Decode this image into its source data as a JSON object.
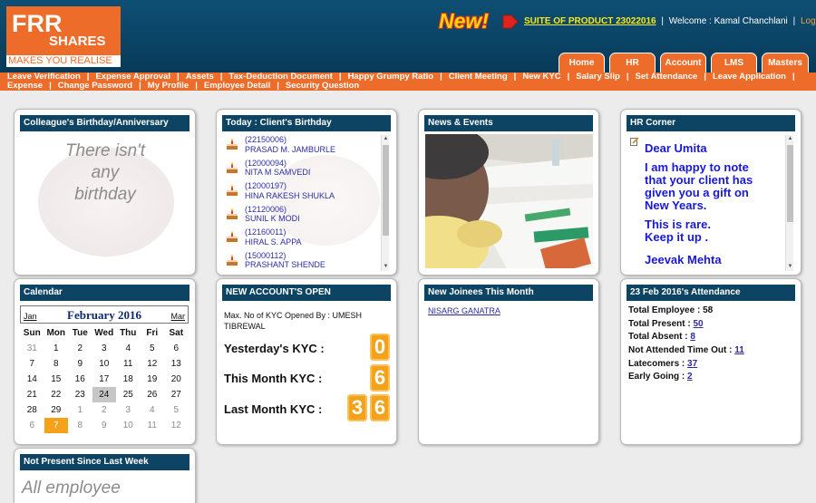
{
  "logo": {
    "line1": "FRR",
    "line2": "SHARES",
    "tagline": "MAKES YOU REALISE"
  },
  "header": {
    "new_badge": "New!",
    "suite_link": "SUITE OF PRODUCT 23022016",
    "welcome": "Welcome : Kamal Chanchlani",
    "logout": "Logout",
    "tabs": [
      "Home",
      "HR",
      "Account",
      "LMS",
      "Masters"
    ]
  },
  "menu": {
    "row1": [
      "Leave Verification",
      "Expense Approval",
      "Assets",
      "Tax-Deduction Document",
      "Happy Grumpy Ratio",
      "Client Meeting",
      "New KYC",
      "Salary Slip",
      "Set Attendance",
      "Leave Application"
    ],
    "row2": [
      "Expense",
      "Change Password",
      "My Profile",
      "Employee Detail",
      "Security Question"
    ]
  },
  "colleague_birthday": {
    "title": "Colleague's Birthday/Anniversary",
    "message": [
      "There isn't",
      "any",
      "birthday"
    ]
  },
  "client_birthday": {
    "title": "Today : Client's Birthday",
    "items": [
      {
        "code": "(22150006)",
        "name": "PRASAD M. JAMBURLE"
      },
      {
        "code": "(12000094)",
        "name": "NITA M SAMVEDI"
      },
      {
        "code": "(12000197)",
        "name": "HINA RAKESH SHUKLA"
      },
      {
        "code": "(12120006)",
        "name": "SUNIL K MODI"
      },
      {
        "code": "(12160011)",
        "name": "HIRAL S. APPA"
      },
      {
        "code": "(15000112)",
        "name": "PRASHANT SHENDE"
      }
    ]
  },
  "news": {
    "title": "News & Events"
  },
  "hr_corner": {
    "title": "HR Corner",
    "lines": [
      "Dear Umita",
      "I am happy to note",
      "that your client has",
      "given you a gift on",
      "New Years.",
      "This is rare.",
      "Keep it up .",
      "Jeevak Mehta"
    ]
  },
  "calendar": {
    "title": "Calendar",
    "month": "February 2016",
    "prev": "Jan",
    "next": "Mar",
    "dow": [
      "Sun",
      "Mon",
      "Tue",
      "Wed",
      "Thu",
      "Fri",
      "Sat"
    ],
    "weeks": [
      [
        "31",
        "1",
        "2",
        "3",
        "4",
        "5",
        "6"
      ],
      [
        "7",
        "8",
        "9",
        "10",
        "11",
        "12",
        "13"
      ],
      [
        "14",
        "15",
        "16",
        "17",
        "18",
        "19",
        "20"
      ],
      [
        "21",
        "22",
        "23",
        "24",
        "25",
        "26",
        "27"
      ],
      [
        "28",
        "29",
        "1",
        "2",
        "3",
        "4",
        "5"
      ],
      [
        "6",
        "7",
        "8",
        "9",
        "10",
        "11",
        "12"
      ]
    ],
    "today": "24",
    "selected": "7"
  },
  "new_account": {
    "title": "NEW ACCOUNT'S OPEN",
    "note": "Max. No of KYC Opened By : UMESH TIBREWAL",
    "yesterday_label": "Yesterday's KYC :",
    "yesterday_value": "0",
    "month_label": "This Month KYC :",
    "month_value": "6",
    "last_month_label": "Last Month KYC :",
    "last_month_digits": [
      "3",
      "6"
    ]
  },
  "new_joinees": {
    "title": "New Joinees This Month",
    "items": [
      "NISARG GANATRA"
    ]
  },
  "attendance": {
    "title": "23 Feb 2016's Attendance",
    "total_employee_label": "Total Employee : ",
    "total_employee": "58",
    "total_present_label": "Total Present : ",
    "total_present": "50",
    "total_absent_label": "Total Absent : ",
    "total_absent": "8",
    "not_attended_label": "Not Attended Time Out : ",
    "not_attended": "11",
    "latecomers_label": "Latecomers : ",
    "latecomers": "37",
    "early_going_label": "Early Going : ",
    "early_going": "2"
  },
  "not_present": {
    "title": "Not Present Since Last Week",
    "message": "All employee"
  }
}
